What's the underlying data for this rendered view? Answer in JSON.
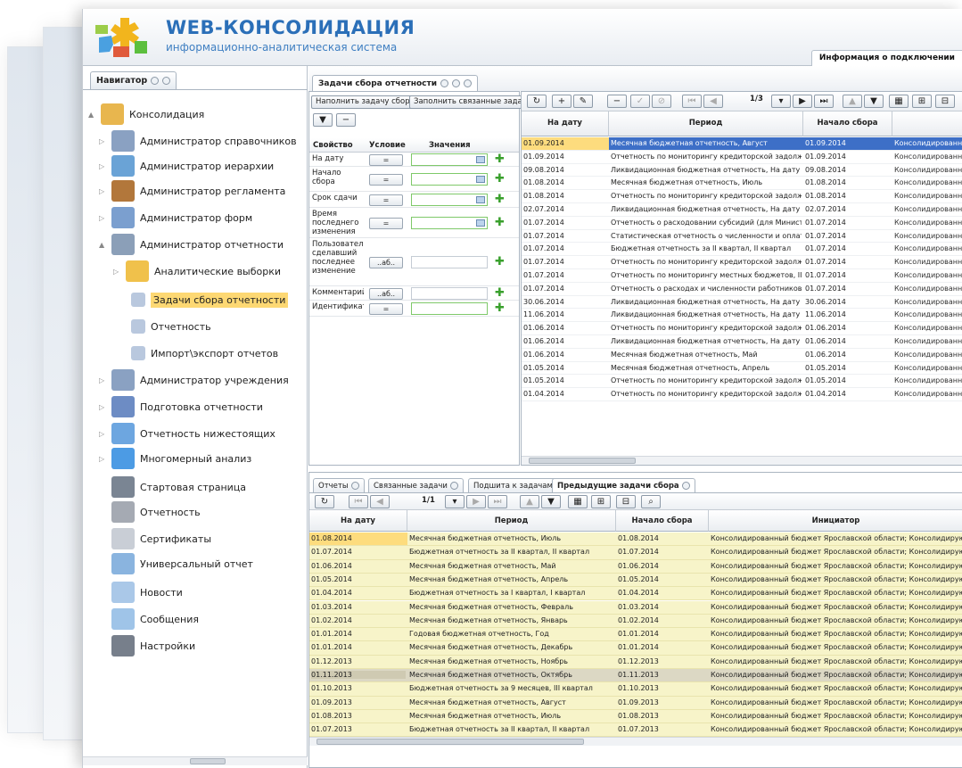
{
  "header": {
    "title": "WEB-КОНСОЛИДАЦИЯ",
    "subtitle": "информационно-аналитическая система",
    "connection_info": "Информация о подключении"
  },
  "navigator": {
    "tab_label": "Навигатор",
    "items": [
      {
        "label": "Консолидация",
        "icon": "consolidation-icon"
      },
      {
        "label": "Администратор справочников",
        "icon": "admin-user-icon"
      },
      {
        "label": "Администратор иерархии",
        "icon": "hierarchy-icon"
      },
      {
        "label": "Администратор регламента",
        "icon": "regulation-icon"
      },
      {
        "label": "Администратор форм",
        "icon": "forms-icon"
      },
      {
        "label": "Администратор отчетности",
        "icon": "reports-admin-icon"
      },
      {
        "label": "Аналитические выборки",
        "icon": "folder-icon"
      },
      {
        "label": "Задачи сбора отчетности",
        "icon": "task-icon"
      },
      {
        "label": "Отчетность",
        "icon": "task-icon"
      },
      {
        "label": "Импорт\\экспорт отчетов",
        "icon": "task-icon"
      },
      {
        "label": "Администратор учреждения",
        "icon": "institution-icon"
      },
      {
        "label": "Подготовка отчетности",
        "icon": "prep-icon"
      },
      {
        "label": "Отчетность нижестоящих",
        "icon": "subordinate-icon"
      },
      {
        "label": "Многомерный анализ",
        "icon": "pie-chart-icon"
      },
      {
        "label": "Стартовая страница",
        "icon": "home-icon"
      },
      {
        "label": "Отчетность",
        "icon": "report-book-icon"
      },
      {
        "label": "Сертификаты",
        "icon": "certificate-icon"
      },
      {
        "label": "Универсальный отчет",
        "icon": "table-icon"
      },
      {
        "label": "Новости",
        "icon": "mail-icon"
      },
      {
        "label": "Сообщения",
        "icon": "message-icon"
      },
      {
        "label": "Настройки",
        "icon": "gear-icon"
      }
    ]
  },
  "tasks_tab": {
    "label": "Задачи сбора отчетности",
    "fill_button": "Наполнить задачу сбора",
    "fill_related_button": "Заполнить связанные задачи"
  },
  "filter": {
    "headers": {
      "property": "Свойство",
      "condition": "Условие",
      "values": "Значения"
    },
    "rows": [
      {
        "property": "На дату",
        "condition": "="
      },
      {
        "property": "Начало сбора",
        "condition": "="
      },
      {
        "property": "Срок сдачи",
        "condition": "="
      },
      {
        "property": "Время последнего изменения",
        "condition": "="
      },
      {
        "property": "Пользовател сделавший последнее изменение",
        "condition": "..аб.."
      },
      {
        "property": "Комментарий",
        "condition": "..аб.."
      },
      {
        "property": "Идентификат",
        "condition": "="
      }
    ]
  },
  "grid1": {
    "page": "1/3",
    "headers": [
      "На дату",
      "Период",
      "Начало сбора",
      ""
    ],
    "rows": [
      [
        "01.09.2014",
        "Месячная бюджетная отчетность, Август",
        "01.09.2014",
        "Консолидированны"
      ],
      [
        "01.09.2014",
        "Отчетность по мониторингу кредиторской задолженност",
        "01.09.2014",
        "Консолидированны"
      ],
      [
        "09.08.2014",
        "Ликвидационная бюджетная отчетность, На дату",
        "09.08.2014",
        "Консолидированны"
      ],
      [
        "01.08.2014",
        "Месячная бюджетная отчетность, Июль",
        "01.08.2014",
        "Консолидированны"
      ],
      [
        "01.08.2014",
        "Отчетность по мониторингу кредиторской задолженност",
        "01.08.2014",
        "Консолидированны"
      ],
      [
        "02.07.2014",
        "Ликвидационная бюджетная отчетность, На дату",
        "02.07.2014",
        "Консолидированны"
      ],
      [
        "01.07.2014",
        "Отчетность о расходовании субсидий (для Министерства",
        "01.07.2014",
        "Консолидированны"
      ],
      [
        "01.07.2014",
        "Статистическая отчетность о численности и оплате труд",
        "01.07.2014",
        "Консолидированны"
      ],
      [
        "01.07.2014",
        "Бюджетная отчетность за II квартал, II квартал",
        "01.07.2014",
        "Консолидированны"
      ],
      [
        "01.07.2014",
        "Отчетность по мониторингу кредиторской задолженност",
        "01.07.2014",
        "Консолидированны"
      ],
      [
        "01.07.2014",
        "Отчетность по мониторингу местных бюджетов, II кварт",
        "01.07.2014",
        "Консолидированны"
      ],
      [
        "01.07.2014",
        "Отчетность о расходах и численности работников органо",
        "01.07.2014",
        "Консолидированны"
      ],
      [
        "30.06.2014",
        "Ликвидационная бюджетная отчетность, На дату",
        "30.06.2014",
        "Консолидированны"
      ],
      [
        "11.06.2014",
        "Ликвидационная бюджетная отчетность, На дату",
        "11.06.2014",
        "Консолидированны"
      ],
      [
        "01.06.2014",
        "Отчетность по мониторингу кредиторской задолженност",
        "01.06.2014",
        "Консолидированны"
      ],
      [
        "01.06.2014",
        "Ликвидационная бюджетная отчетность, На дату",
        "01.06.2014",
        "Консолидированны"
      ],
      [
        "01.06.2014",
        "Месячная бюджетная отчетность, Май",
        "01.06.2014",
        "Консолидированны"
      ],
      [
        "01.05.2014",
        "Месячная бюджетная отчетность, Апрель",
        "01.05.2014",
        "Консолидированны"
      ],
      [
        "01.05.2014",
        "Отчетность по мониторингу кредиторской задолженност",
        "01.05.2014",
        "Консолидированны"
      ],
      [
        "01.04.2014",
        "Отчетность по мониторингу кредиторской задолженност",
        "01.04.2014",
        "Консолидированны"
      ]
    ]
  },
  "bottom": {
    "tabs": [
      "Отчеты",
      "Связанные задачи",
      "Подшита к задачам",
      "Предыдущие задачи сбора"
    ],
    "page": "1/1",
    "headers": [
      "На дату",
      "Период",
      "Начало сбора",
      "Инициатор"
    ],
    "initiator": "Консолидированный бюджет Ярославской области; Консолидирующий ФО;",
    "rows": [
      [
        "01.08.2014",
        "Месячная бюджетная отчетность, Июль",
        "01.08.2014"
      ],
      [
        "01.07.2014",
        "Бюджетная отчетность за II квартал, II квартал",
        "01.07.2014"
      ],
      [
        "01.06.2014",
        "Месячная бюджетная отчетность, Май",
        "01.06.2014"
      ],
      [
        "01.05.2014",
        "Месячная бюджетная отчетность, Апрель",
        "01.05.2014"
      ],
      [
        "01.04.2014",
        "Бюджетная отчетность за I квартал, I квартал",
        "01.04.2014"
      ],
      [
        "01.03.2014",
        "Месячная бюджетная отчетность, Февраль",
        "01.03.2014"
      ],
      [
        "01.02.2014",
        "Месячная бюджетная отчетность, Январь",
        "01.02.2014"
      ],
      [
        "01.01.2014",
        "Годовая бюджетная отчетность, Год",
        "01.01.2014"
      ],
      [
        "01.01.2014",
        "Месячная бюджетная отчетность, Декабрь",
        "01.01.2014"
      ],
      [
        "01.12.2013",
        "Месячная бюджетная отчетность, Ноябрь",
        "01.12.2013"
      ],
      [
        "01.11.2013",
        "Месячная бюджетная отчетность, Октябрь",
        "01.11.2013"
      ],
      [
        "01.10.2013",
        "Бюджетная отчетность за 9 месяцев, III квартал",
        "01.10.2013"
      ],
      [
        "01.09.2013",
        "Месячная бюджетная отчетность, Август",
        "01.09.2013"
      ],
      [
        "01.08.2013",
        "Месячная бюджетная отчетность, Июль",
        "01.08.2013"
      ],
      [
        "01.07.2013",
        "Бюджетная отчетность за II квартал, II квартал",
        "01.07.2013"
      ]
    ]
  }
}
